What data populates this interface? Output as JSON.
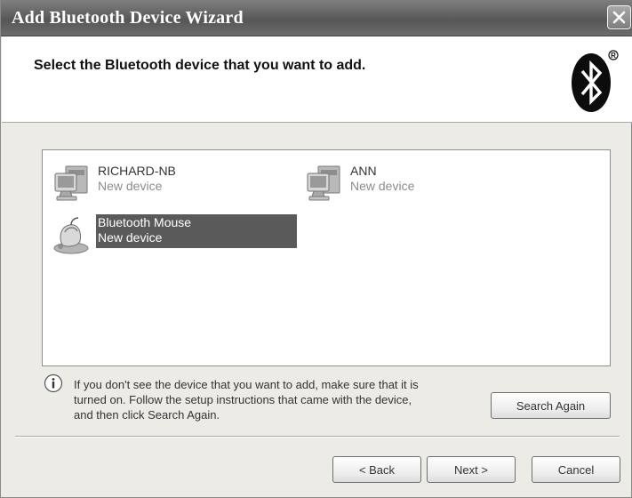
{
  "window": {
    "title": "Add Bluetooth Device Wizard"
  },
  "header": {
    "instruction": "Select the Bluetooth device that you want to add.",
    "logo_icon": "bluetooth-logo"
  },
  "devices": [
    {
      "name": "RICHARD-NB",
      "status": "New device",
      "icon": "computer-icon",
      "selected": false
    },
    {
      "name": "ANN",
      "status": "New device",
      "icon": "computer-icon",
      "selected": false
    },
    {
      "name": "Bluetooth Mouse",
      "status": "New device",
      "icon": "mouse-icon",
      "selected": true
    }
  ],
  "help": {
    "icon": "info-icon",
    "text_lines": [
      "If you don't see the device that you want to add, make sure that it is",
      "turned on. Follow the setup instructions that came with the device,",
      "and then click Search Again."
    ]
  },
  "buttons": {
    "search_again": "Search Again",
    "back": "< Back",
    "next": "Next >",
    "cancel": "Cancel"
  }
}
